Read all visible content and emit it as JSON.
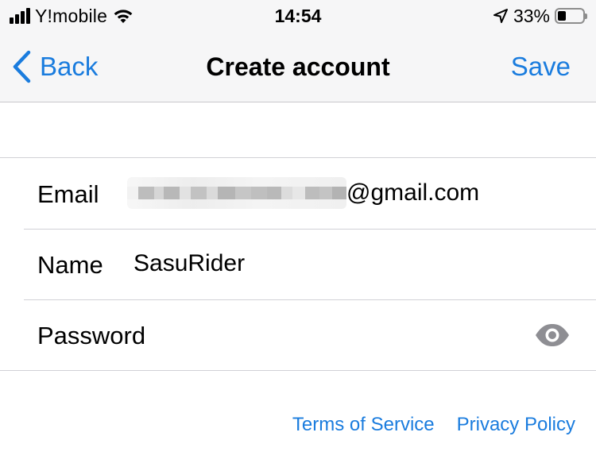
{
  "status_bar": {
    "carrier": "Y!mobile",
    "time": "14:54",
    "battery_percent": "33%",
    "battery_level": 0.33,
    "icons": [
      "signal-bars-icon",
      "wifi-icon",
      "location-arrow-icon",
      "battery-icon"
    ]
  },
  "nav": {
    "back_label": "Back",
    "title": "Create account",
    "save_label": "Save"
  },
  "form": {
    "email": {
      "label": "Email",
      "value_visible_suffix": "@gmail.com"
    },
    "name": {
      "label": "Name",
      "value": "SasuRider"
    },
    "password": {
      "label": "Password",
      "value": "",
      "toggle_icon": "eye-icon"
    }
  },
  "footer": {
    "terms": "Terms of Service",
    "privacy": "Privacy Policy"
  },
  "colors": {
    "accent": "#1a7cde",
    "bar_background": "#f6f6f7",
    "separator": "#d1d1d6",
    "eye_icon": "#8e8e93"
  }
}
